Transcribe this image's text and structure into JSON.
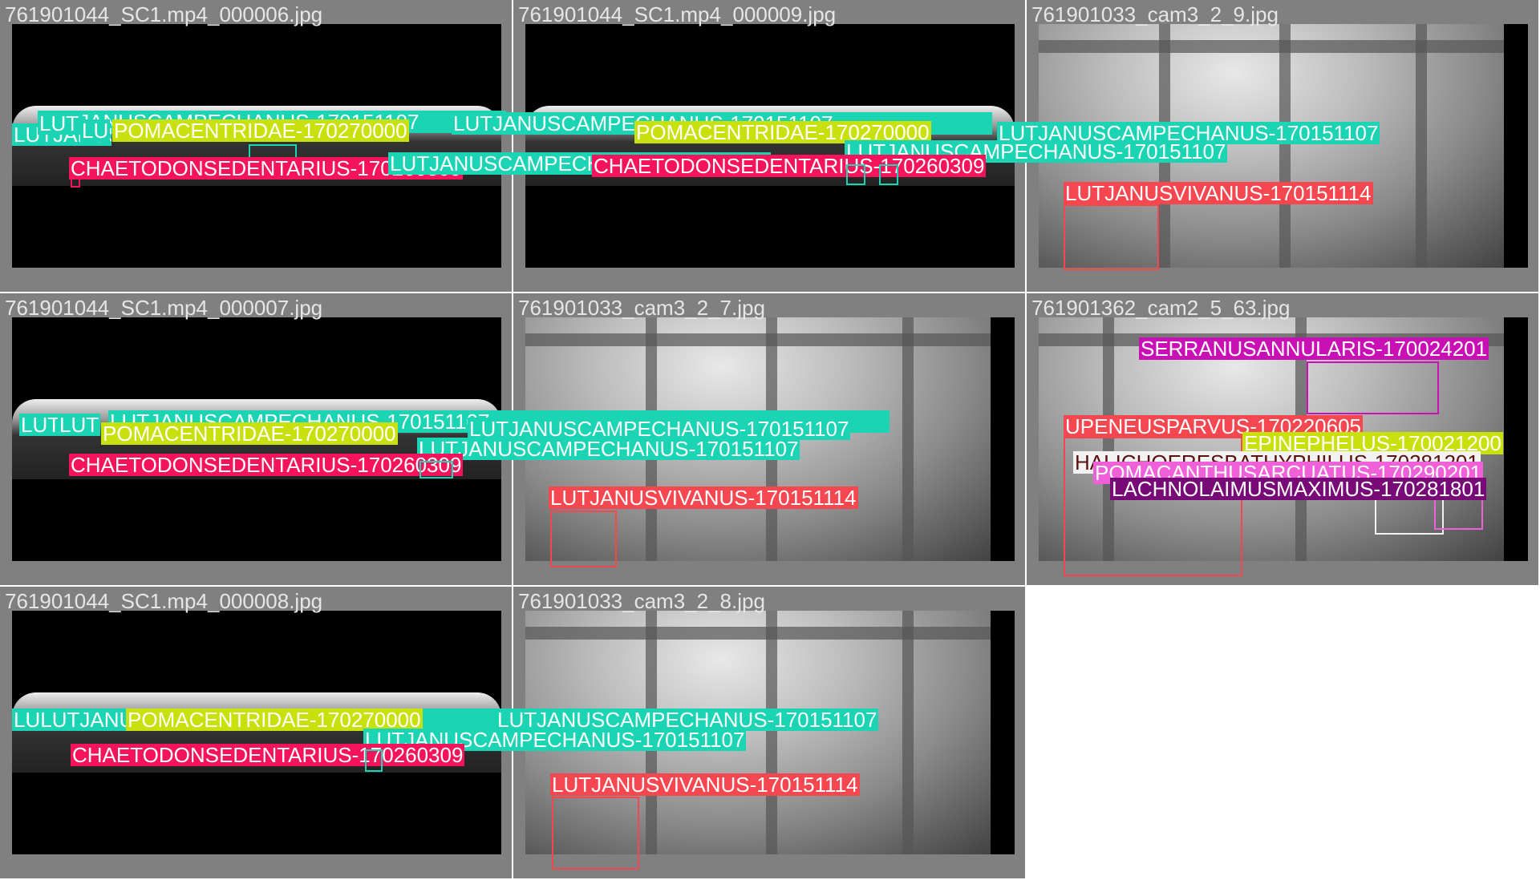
{
  "colors": {
    "cyan": "#1ad4b4",
    "yellow": "#c8e00c",
    "pink": "#f5145c",
    "red": "#f5474f",
    "magenta": "#c810b4",
    "white": "#f2f2f2",
    "light_pink": "#f060d8",
    "purple": "#780a78"
  },
  "tiles": [
    {
      "title": "761901044_SC1.mp4_000006.jpg",
      "labels": [
        "LUTJANUSCAMPECHANUS-170151107",
        "LUTJANUSCAMPECHANUS-170151107",
        "LUT",
        "LU",
        "POMACENTRIDAE-170270000",
        "CHAETODONSEDENTARIUS-170260309",
        "LUTJANUSCAMPECHANUS-170151107"
      ]
    },
    {
      "title": "761901044_SC1.mp4_000009.jpg",
      "labels": [
        "LUTJANUSCAMPECHANUS-170151107",
        "POMACENTRIDAE-170270000",
        "LUTJANUSCAMPECHANUS-170151107",
        "LUTJANUSCAMPECHANUS-170151107",
        "CHAETODONSEDENTARIUS-170260309"
      ]
    },
    {
      "title": "761901033_cam3_2_9.jpg",
      "labels": [
        "LUTJANUSVIVANUS-170151114"
      ]
    },
    {
      "title": "761901044_SC1.mp4_000007.jpg",
      "labels": [
        "LUTJANUSCAMPECHANUS-170151107",
        "LUT",
        "LUT",
        "POMACENTRIDAE-170270000",
        "LUTJANUSCAMPECHANUS-170151107",
        "LUTJANUSCAMPECHANUS-170151107",
        "CHAETODONSEDENTARIUS-170260309"
      ]
    },
    {
      "title": "761901033_cam3_2_7.jpg",
      "labels": [
        "LUTJANUSVIVANUS-170151114"
      ]
    },
    {
      "title": "761901362_cam2_5_63.jpg",
      "labels": [
        "SERRANUSANNULARIS-170024201",
        "UPENEUSPARVUS-170220605",
        "EPINEPHELUS-170021200",
        "HALICHOERESBATHYPHILUS-170281201",
        "POMACANTHUSARCUATUS-170290201",
        "LACHNOLAIMUSMAXIMUS-170281801"
      ]
    },
    {
      "title": "761901044_SC1.mp4_000008.jpg",
      "labels": [
        "LULUTJANUSCAMPECHANUS-170151107",
        "POMACENTRIDAE-170270000",
        "LUTJANUSCAMPECHANUS-170151107",
        "LUTJANUSCAMPECHANUS-170151107",
        "CHAETODONSEDENTARIUS-170260309"
      ]
    },
    {
      "title": "761901033_cam3_2_8.jpg",
      "labels": [
        "LUTJANUSVIVANUS-170151114"
      ]
    }
  ]
}
